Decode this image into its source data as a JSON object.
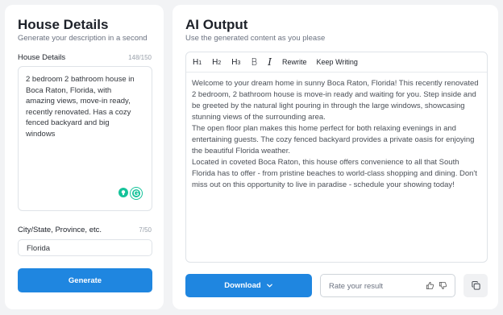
{
  "left_panel": {
    "title": "House Details",
    "subtitle": "Generate your description in a second",
    "details_label": "House Details",
    "details_counter": "148/150",
    "details_text": "2 bedroom 2 bathroom house in\nBoca Raton, Florida, with\namazing views, move-in ready,\nrecently renovated. Has a cozy\nfenced backyard and big\nwindows",
    "city_label": "City/State, Province, etc.",
    "city_counter": "7/50",
    "city_value": "Florida",
    "generate_label": "Generate"
  },
  "right_panel": {
    "title": "AI Output",
    "subtitle": "Use the generated content as you please",
    "toolbar": {
      "h1": "H",
      "h1_sub": "1",
      "h2": "H",
      "h2_sub": "2",
      "h3": "H",
      "h3_sub": "3",
      "bold": "B",
      "italic": "I",
      "rewrite": "Rewrite",
      "keep_writing": "Keep Writing"
    },
    "output_paragraphs": [
      "Welcome to your dream home in sunny Boca Raton, Florida! This recently renovated 2 bedroom, 2 bathroom house is move-in ready and waiting for you. Step inside and be greeted by the natural light pouring in through the large windows, showcasing stunning views of the surrounding area.",
      "The open floor plan makes this home perfect for both relaxing evenings in and entertaining guests. The cozy fenced backyard provides a private oasis for enjoying the beautiful Florida weather.",
      "Located in coveted Boca Raton, this house offers convenience to all that South Florida has to offer - from pristine beaches to world-class shopping and dining. Don't miss out on this opportunity to live in paradise - schedule your showing today!"
    ],
    "download_label": "Download",
    "rate_label": "Rate your result"
  },
  "colors": {
    "accent": "#1f86e0",
    "grammarly": "#15c39a",
    "background": "#f2f3f5"
  },
  "icons": {
    "download_chevron": "chevron-down-icon",
    "thumbs_up": "thumbs-up-icon",
    "thumbs_down": "thumbs-down-icon",
    "copy": "copy-icon",
    "grammarly_bulb": "lightbulb-icon",
    "grammarly_logo": "grammarly-icon"
  }
}
